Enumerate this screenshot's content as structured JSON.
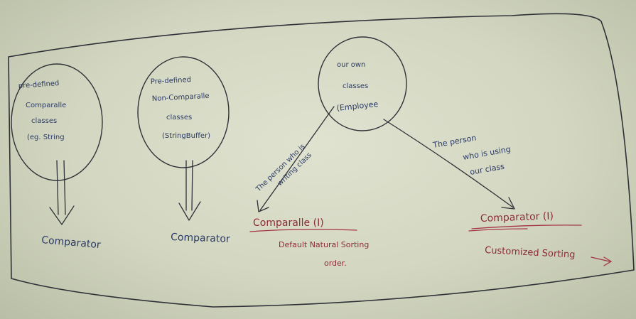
{
  "nodes": {
    "predefined_comparable": {
      "lines": [
        "pre-defined",
        "Comparalle",
        "classes",
        "(eg. String"
      ]
    },
    "predefined_non_comparable": {
      "lines": [
        "Pre-defined",
        "Non-Comparalle",
        "classes",
        "(StringBuffer)"
      ]
    },
    "own_classes": {
      "lines": [
        "our own",
        "classes",
        "(Employee"
      ]
    }
  },
  "targets": {
    "comparator_left": "Comparator",
    "comparator_middle": "Comparator",
    "comparable_interface": "Comparalle (I)",
    "comparable_desc_line1": "Default Natural Sorting",
    "comparable_desc_line2": "order.",
    "comparator_interface": "Comparator (I)",
    "comparator_desc": "Customized Sorting"
  },
  "edge_labels": {
    "writing_line1": "The person who is",
    "writing_line2": "writing class",
    "using_line1": "The person",
    "using_line2": "who is using",
    "using_line3": "our class"
  },
  "colors": {
    "blue_ink": "#2b3a66",
    "red_ink": "#8e2b35",
    "dark_ink": "#2f3138"
  }
}
